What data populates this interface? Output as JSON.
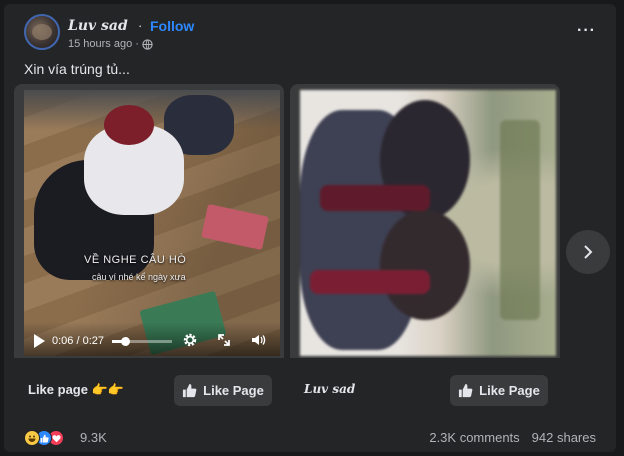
{
  "post": {
    "author": "𝑳𝒖𝒗 𝒔𝒂𝒅",
    "separator": "·",
    "follow_label": "Follow",
    "time": "15 hours ago",
    "meta_dot": "·",
    "privacy_icon": "globe-icon",
    "more_label": "···",
    "caption": "Xin vía trúng tủ..."
  },
  "cards": [
    {
      "video": {
        "overlay_title": "VỀ NGHE CÂU HÒ",
        "overlay_subtitle": "câu ví nhé kể ngày xưa",
        "time": "0:06 / 0:27",
        "progress": 0.22
      },
      "footer_label": "Like page 👉👉",
      "like_button": "Like Page"
    },
    {
      "footer_label": "𝑳𝒖𝒗 𝒔𝒂𝒅",
      "like_button": "Like Page"
    }
  ],
  "stats": {
    "reactions": [
      "haha",
      "like",
      "love"
    ],
    "reaction_count": "9.3K",
    "comments": "2.3K comments",
    "shares": "942 shares"
  },
  "colors": {
    "accent": "#2d88ff",
    "card_bg": "#242526",
    "button_bg": "#3a3b3c"
  }
}
